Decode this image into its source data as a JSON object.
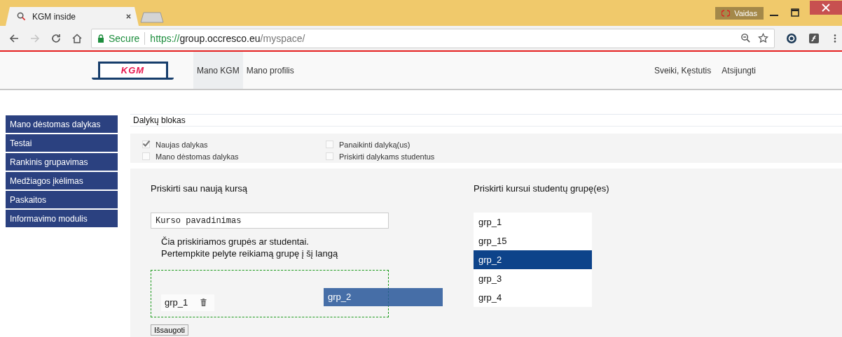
{
  "browser": {
    "tab": {
      "title": "KGM inside"
    },
    "profile": "Vaidas",
    "forward_disabled": true,
    "url": {
      "secure_label": "Secure",
      "scheme": "https://",
      "host": "group.occresco.eu",
      "path": "/myspace/"
    }
  },
  "header": {
    "logo": "KGM",
    "nav": [
      {
        "label": "Mano KGM",
        "selected": true
      },
      {
        "label": "Mano profilis",
        "selected": false
      }
    ],
    "greeting": "Sveiki, Kęstutis",
    "logout": "Atsijungti"
  },
  "sidebar": {
    "items": [
      "Mano dėstomas dalykas",
      "Testai",
      "Rankinis grupavimas",
      "Medžiagos įkėlimas",
      "Paskaitos",
      "Informavimo modulis"
    ]
  },
  "block_title": "Dalykų blokas",
  "options": [
    {
      "label": "Naujas dalykas",
      "checked": true
    },
    {
      "label": "Panaikinti dalyką(us)",
      "checked": false
    },
    {
      "label": "Mano dėstomas dalykas",
      "checked": false
    },
    {
      "label": "Priskirti dalykams studentus",
      "checked": false
    }
  ],
  "course": {
    "heading": "Priskirti sau naują kursą",
    "name_value": "Kurso pavadinimas",
    "hint_lines": [
      "Čia priskiriamos grupės ar studentai.",
      "Pertempkite pelyte reikiamą grupę į šį langą"
    ],
    "assigned": [
      {
        "name": "grp_1"
      }
    ],
    "dragging": {
      "name": "grp_2"
    },
    "save_button": "Išsaugoti"
  },
  "groups": {
    "heading": "Priskirti kursui studentų grupę(es)",
    "items": [
      {
        "name": "grp_1",
        "selected": false
      },
      {
        "name": "grp_15",
        "selected": false
      },
      {
        "name": "grp_2",
        "selected": true
      },
      {
        "name": "grp_3",
        "selected": false
      },
      {
        "name": "grp_4",
        "selected": false
      }
    ]
  }
}
